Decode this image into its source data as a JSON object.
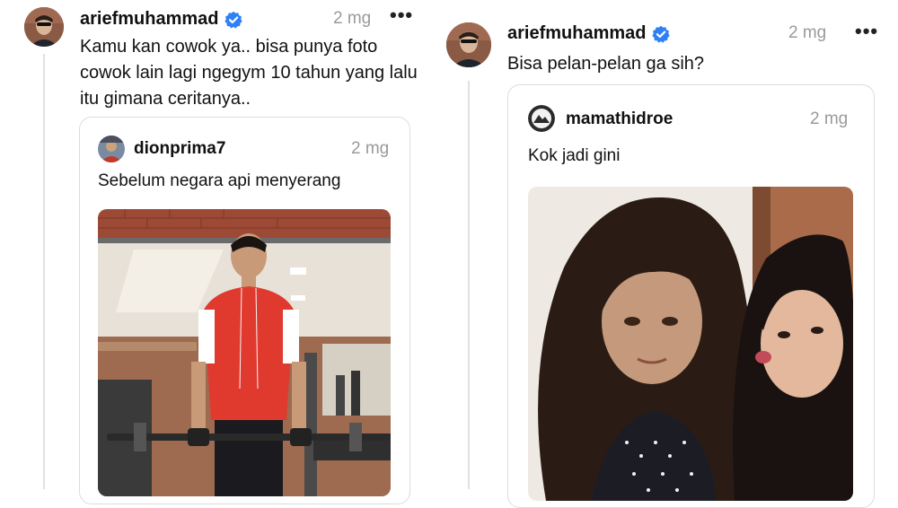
{
  "colors": {
    "verified": "#2f80f7",
    "muted": "#9a9a9a",
    "border": "#dcdcdc"
  },
  "left_post": {
    "username": "ariefmuhammad",
    "time": "2 mg",
    "more_icon": "more-horizontal-icon",
    "text_lines": [
      "Kamu kan cowok ya.. bisa punya foto",
      "cowok lain lagi ngegym 10 tahun yang lalu",
      "itu gimana ceritanya.."
    ],
    "quote": {
      "username": "dionprima7",
      "time": "2 mg",
      "text": "Sebelum negara api menyerang"
    }
  },
  "right_post": {
    "username": "ariefmuhammad",
    "time": "2 mg",
    "more_icon": "more-horizontal-icon",
    "text": "Bisa pelan-pelan ga sih?",
    "quote": {
      "username": "mamathidroe",
      "time": "2 mg",
      "text": "Kok jadi gini"
    }
  }
}
